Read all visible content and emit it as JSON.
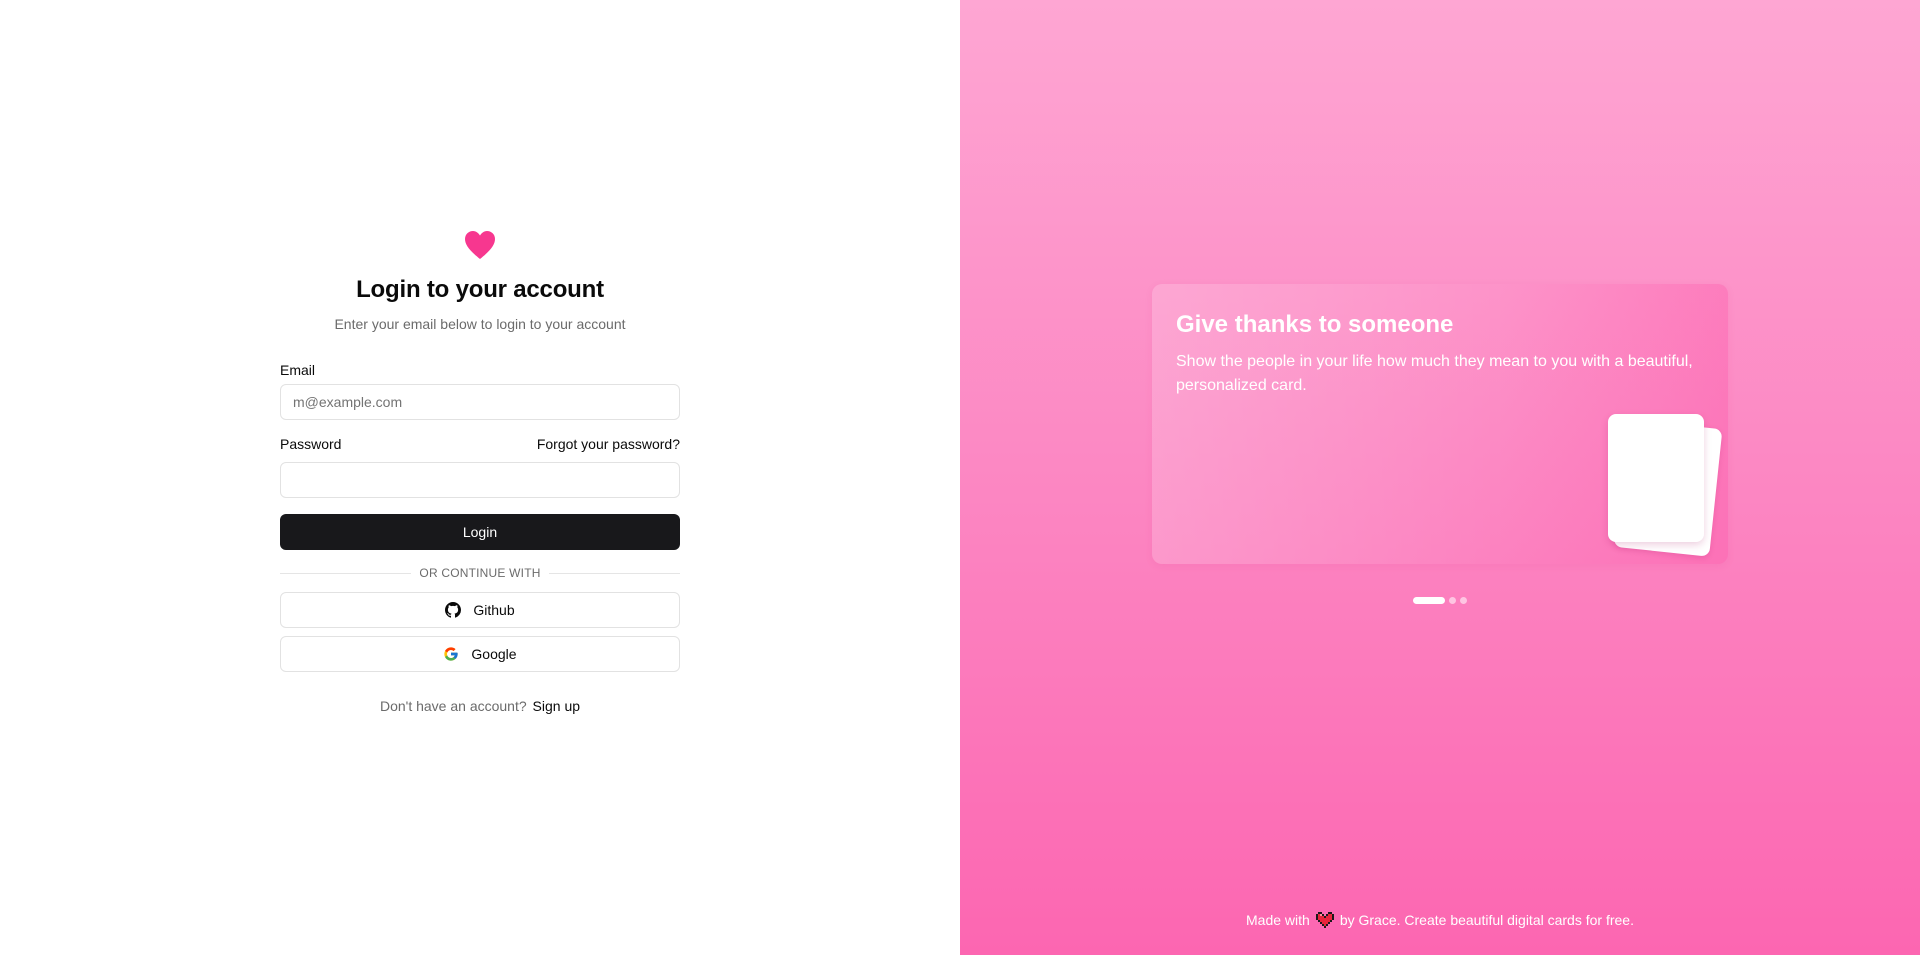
{
  "login": {
    "title": "Login to your account",
    "subtitle": "Enter your email below to login to your account",
    "email_label": "Email",
    "email_placeholder": "m@example.com",
    "email_value": "",
    "password_label": "Password",
    "forgot_label": "Forgot your password?",
    "password_value": "",
    "login_button": "Login",
    "divider_text": "OR CONTINUE WITH",
    "github_label": "Github",
    "google_label": "Google",
    "signup_prompt": "Don't have an account?",
    "signup_link": "Sign up"
  },
  "promo": {
    "card_title": "Give thanks to someone",
    "card_description": "Show the people in your life how much they mean to you with a beautiful, personalized card.",
    "carousel": {
      "total": 3,
      "active": 1
    },
    "footer_prefix": "Made with",
    "footer_suffix": "by Grace. Create beautiful digital cards for free."
  },
  "colors": {
    "brand_pink": "#f7378f",
    "primary_button": "#18181b",
    "panel_gradient_top": "#fea6d3",
    "panel_gradient_bottom": "#fc66b1"
  },
  "icons": {
    "logo": "heart-icon",
    "github": "github-icon",
    "google": "google-icon",
    "footer": "pixel-heart-icon"
  }
}
